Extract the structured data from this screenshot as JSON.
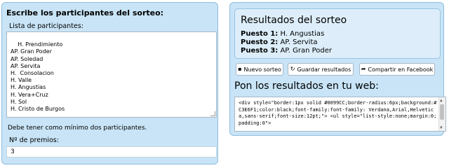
{
  "left": {
    "title": "Escribe los participantes del sorteo:",
    "list_label": "Lista de participantes:",
    "participants": "H. Prendimiento\nAP. Gran Poder\nAP. Soledad\nAP. Servita\nH.  Consolacion\nH. Valle\nH. Angustias\nH. Vera+Cruz\nH. Sol\nH. Cristo de Burgos",
    "hint": "Debe tener como mínimo dos participantes.",
    "prizes_label": "Nº de premios:",
    "prizes_value": "3"
  },
  "right": {
    "results_title": "Resultados del sorteo",
    "results": [
      {
        "label": "Puesto 1:",
        "value": " H. Angustias"
      },
      {
        "label": "Puesto 2:",
        "value": " AP. Servita"
      },
      {
        "label": "Puesto 3:",
        "value": " AP. Gran Poder"
      }
    ],
    "buttons": {
      "new": "Nuevo sorteo",
      "save": "Guardar resultados",
      "share": "Compartir en Facebook"
    },
    "icons": {
      "new": "document-icon",
      "save": "refresh-save-icon",
      "share": "share-arrow-icon"
    },
    "embed_title": "Pon los resultados en tu web:",
    "embed_code": "<div style=\"border:1px solid #0099CC;border-radius:6px;background:#C3E6F1;color:black;font-family:font-family: Verdana,Arial,Helvetica,sans-serif;font-size:12pt;\"> <ul style=\"list-style:none;margin:0;padding:0\">"
  }
}
